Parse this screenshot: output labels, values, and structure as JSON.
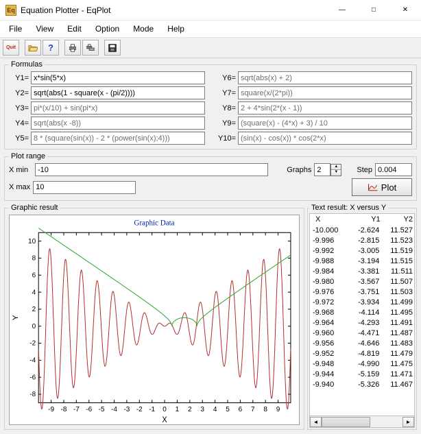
{
  "window": {
    "title": "Equation Plotter - EqPlot"
  },
  "menu": {
    "file": "File",
    "view": "View",
    "edit": "Edit",
    "option": "Option",
    "mode": "Mode",
    "help": "Help"
  },
  "toolbar": {
    "quit": "Quit"
  },
  "formulas": {
    "legend": "Formulas",
    "labels": {
      "y1": "Y1=",
      "y2": "Y2=",
      "y3": "Y3=",
      "y4": "Y4=",
      "y5": "Y5=",
      "y6": "Y6=",
      "y7": "Y7=",
      "y8": "Y8=",
      "y9": "Y9=",
      "y10": "Y10="
    },
    "values": {
      "y1": "x*sin(5*x)",
      "y2": "sqrt(abs(1 - square(x - (pi/2))))",
      "y3": "pi*(x/10) + sin(pi*x)",
      "y4": "sqrt(abs(x -8))",
      "y5": "8 * (square(sin(x)) - 2 * (power(sin(x);4)))",
      "y6": "sqrt(abs(x) + 2)",
      "y7": "square(x/(2*pi))",
      "y8": "2 + 4*sin(2*(x - 1))",
      "y9": "(square(x) - (4*x) + 3) / 10",
      "y10": "(sin(x) - cos(x)) * cos(2*x)"
    }
  },
  "plotrange": {
    "legend": "Plot range",
    "xmin_label": "X min",
    "xmin": "-10",
    "xmax_label": "X max",
    "xmax": "10",
    "graphs_label": "Graphs",
    "graphs": "2",
    "step_label": "Step",
    "step": "0.004",
    "plot_btn": "Plot"
  },
  "graphic": {
    "legend": "Graphic result",
    "title": "Graphic Data",
    "ylabel": "Y",
    "xlabel": "X"
  },
  "textresult": {
    "legend": "Text result: X versus Y",
    "col_x": "X",
    "col_y1": "Y1",
    "col_y2": "Y2",
    "rows": [
      {
        "x": "-10.000",
        "y1": "-2.624",
        "y2": "11.527"
      },
      {
        "x": "-9.996",
        "y1": "-2.815",
        "y2": "11.523"
      },
      {
        "x": "-9.992",
        "y1": "-3.005",
        "y2": "11.519"
      },
      {
        "x": "-9.988",
        "y1": "-3.194",
        "y2": "11.515"
      },
      {
        "x": "-9.984",
        "y1": "-3.381",
        "y2": "11.511"
      },
      {
        "x": "-9.980",
        "y1": "-3.567",
        "y2": "11.507"
      },
      {
        "x": "-9.976",
        "y1": "-3.751",
        "y2": "11.503"
      },
      {
        "x": "-9.972",
        "y1": "-3.934",
        "y2": "11.499"
      },
      {
        "x": "-9.968",
        "y1": "-4.114",
        "y2": "11.495"
      },
      {
        "x": "-9.964",
        "y1": "-4.293",
        "y2": "11.491"
      },
      {
        "x": "-9.960",
        "y1": "-4.471",
        "y2": "11.487"
      },
      {
        "x": "-9.956",
        "y1": "-4.646",
        "y2": "11.483"
      },
      {
        "x": "-9.952",
        "y1": "-4.819",
        "y2": "11.479"
      },
      {
        "x": "-9.948",
        "y1": "-4.990",
        "y2": "11.475"
      },
      {
        "x": "-9.944",
        "y1": "-5.159",
        "y2": "11.471"
      },
      {
        "x": "-9.940",
        "y1": "-5.326",
        "y2": "11.467"
      }
    ]
  },
  "chart_data": {
    "type": "line",
    "title": "Graphic Data",
    "xlabel": "X",
    "ylabel": "Y",
    "xlim": [
      -10,
      10
    ],
    "ylim": [
      -9,
      11
    ],
    "x_ticks": [
      -9,
      -8,
      -7,
      -6,
      -5,
      -4,
      -3,
      -2,
      -1,
      0,
      1,
      2,
      3,
      4,
      5,
      6,
      7,
      8,
      9
    ],
    "y_ticks": [
      -8,
      -6,
      -4,
      -2,
      0,
      2,
      4,
      6,
      8,
      10
    ],
    "series": [
      {
        "name": "Y1 = x*sin(5*x)",
        "color": "#b23030",
        "formula": "x*sin(5*x)"
      },
      {
        "name": "Y2 = sqrt(abs(1 - (x - pi/2)^2))",
        "color": "#2faa2f",
        "formula": "sqrt(abs(1-square(x-pi/2)))"
      }
    ]
  }
}
